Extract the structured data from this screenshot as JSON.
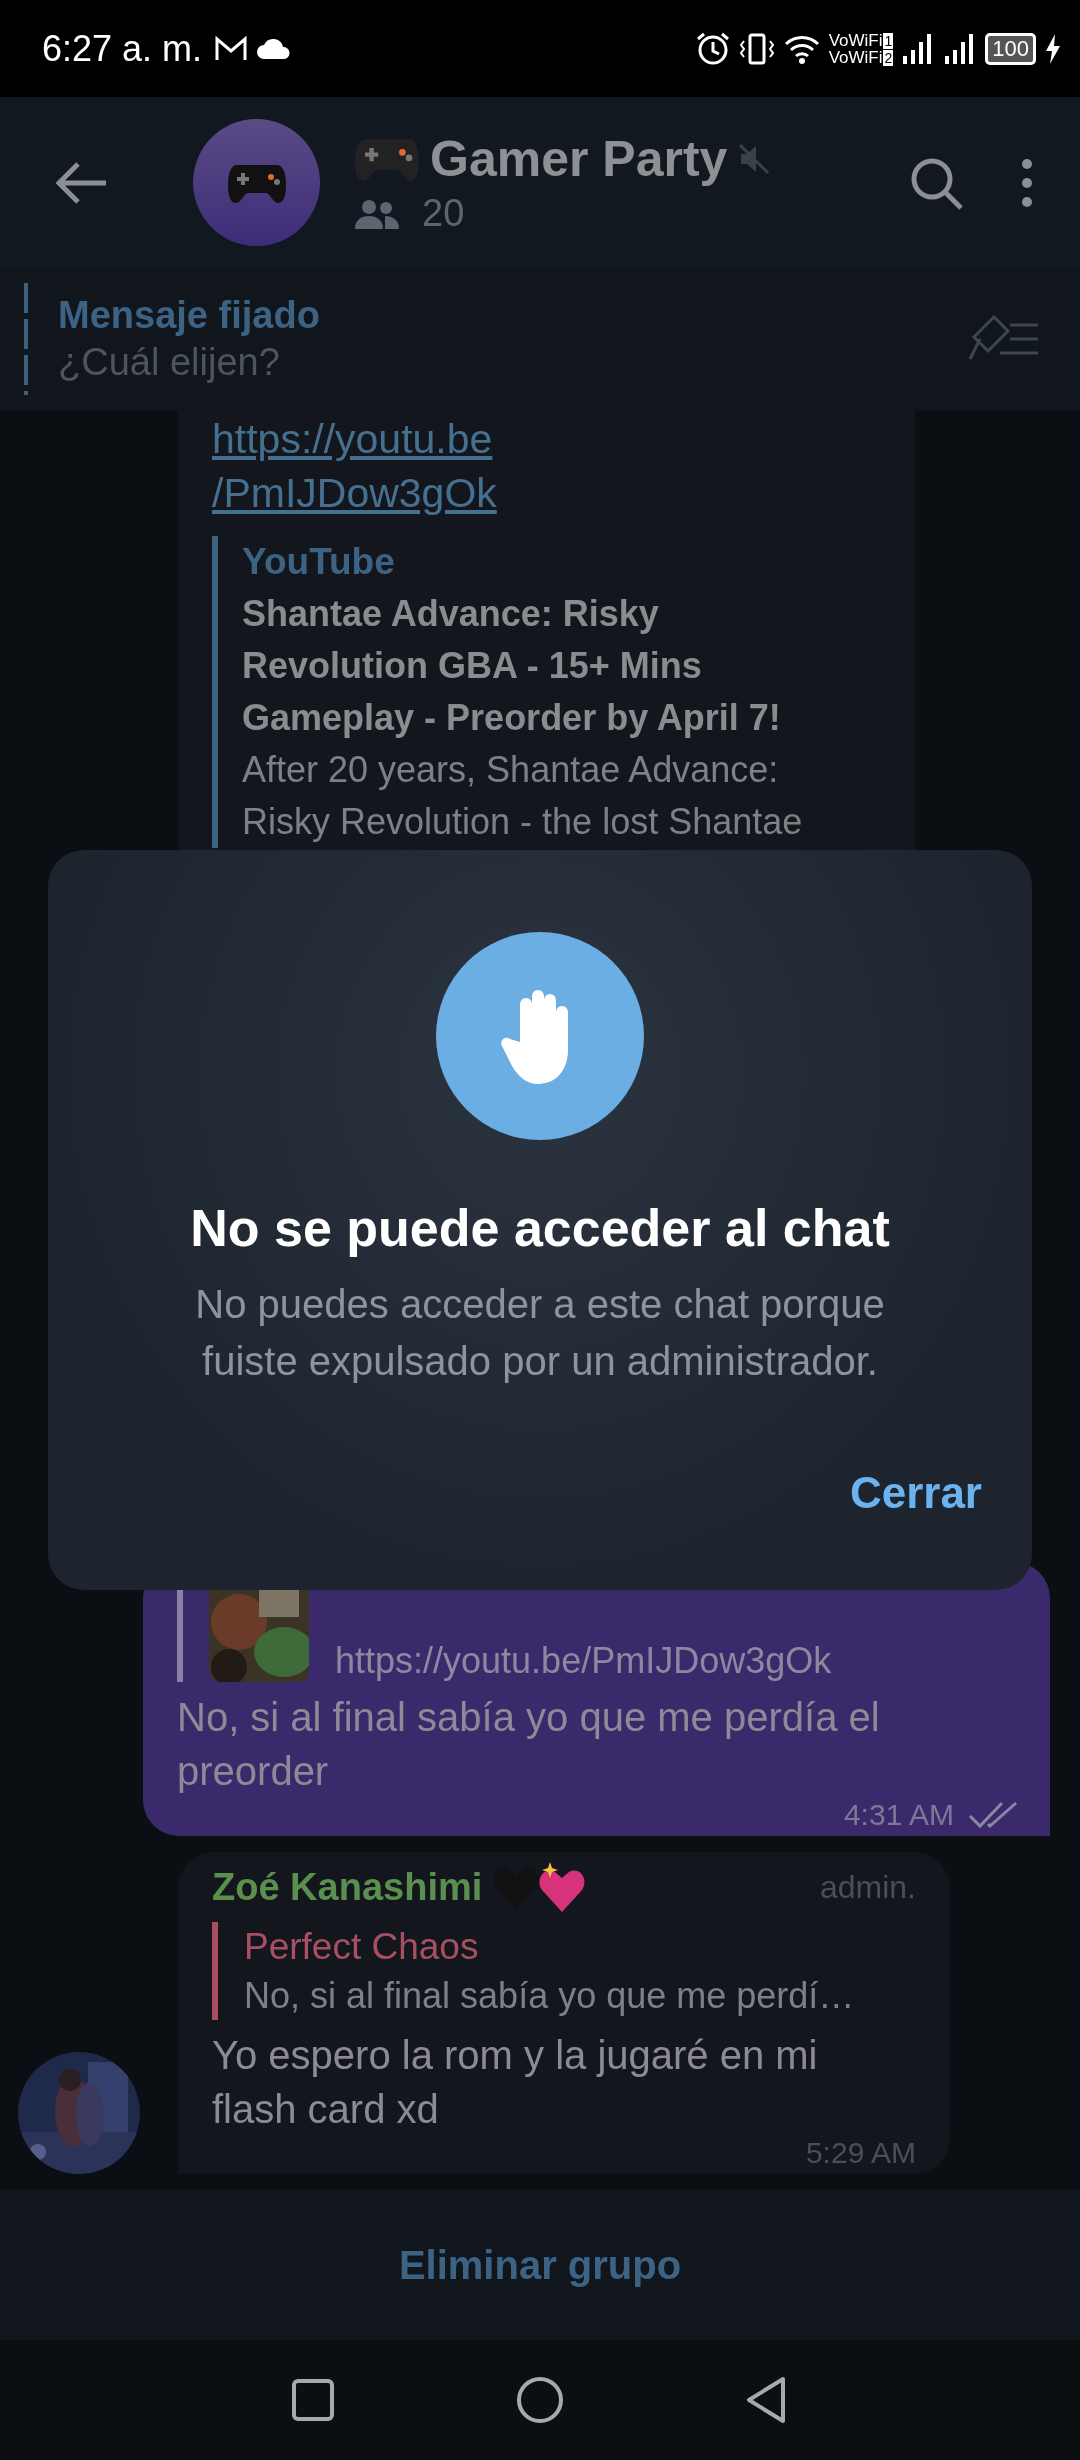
{
  "status_bar": {
    "time": "6:27 a. m.",
    "networks": [
      {
        "label": "VoWiFi",
        "sim": "1"
      },
      {
        "label": "VoWiFi",
        "sim": "2"
      }
    ],
    "battery": "100"
  },
  "header": {
    "title": "Gamer Party",
    "muted": true,
    "members": "20"
  },
  "pinned": {
    "label": "Mensaje fijado",
    "text": "¿Cuál elijen?"
  },
  "messages": [
    {
      "kind": "link_preview",
      "link_lines": [
        "https://youtu.be",
        "/PmIJDow3gOk"
      ],
      "site": "YouTube",
      "title": "Shantae Advance: Risky Revolution GBA - 15+ Mins Gameplay - Preorder by April 7!",
      "description": "After 20 years, Shantae Advance: Risky Revolution - the lost Shantae"
    },
    {
      "kind": "outgoing",
      "reply_link": "https://youtu.be/PmIJDow3gOk",
      "text": "No, si al final sabía yo que me perdía el preorder",
      "time": "4:31 AM",
      "read": true
    },
    {
      "kind": "incoming",
      "sender": "Zoé Kanashimi",
      "color": "#5b8f4d",
      "badge": "admin.",
      "reply": {
        "sender": "Perfect Chaos",
        "color": "#a84f62",
        "text": "No, si al final sabía yo que me perdí…"
      },
      "text": "Yo espero la rom y la jugaré en mi flash card xd",
      "time": "5:29 AM"
    }
  ],
  "dialog": {
    "title": "No se puede acceder al chat",
    "message": "No puedes acceder a este chat porque fuiste expulsado por un administrador.",
    "button": "Cerrar"
  },
  "bottom_action": "Eliminar grupo"
}
